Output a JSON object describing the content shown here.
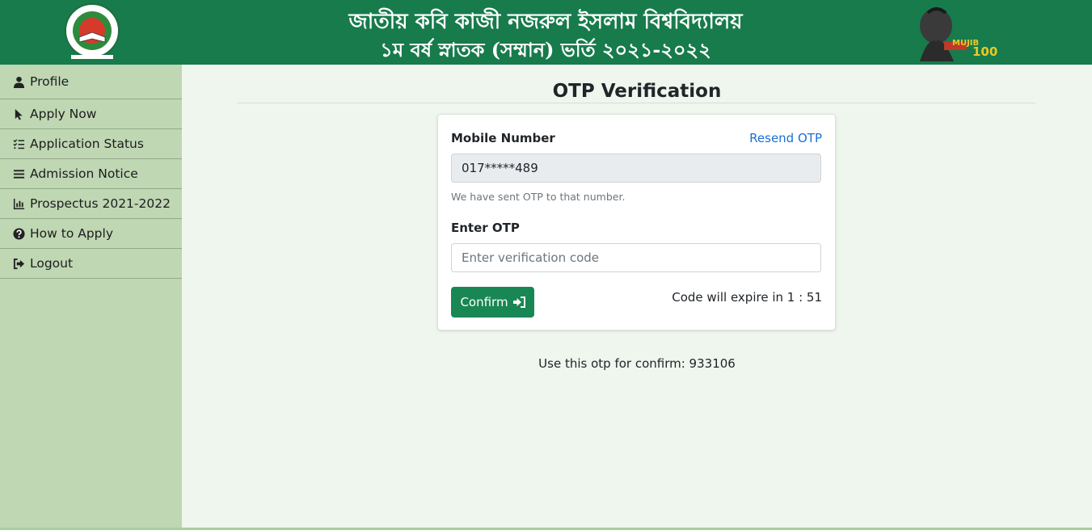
{
  "header": {
    "title_line1": "জাতীয় কবি কাজী নজরুল ইসলাম বিশ্ববিদ্যালয়",
    "title_line2": "১ম বর্ষ স্নাতক (সম্মান) ভর্তি ২০২১-২০২২",
    "logo_icon": "university-seal-logo",
    "mujib_logo_text": "MUJIB",
    "mujib_logo_number": "100",
    "brand_color": "#177b4c"
  },
  "sidebar": {
    "background": "#bfd7b3",
    "items": [
      {
        "label": "Profile",
        "icon": "user-icon"
      },
      {
        "label": "Apply Now",
        "icon": "cursor-icon"
      },
      {
        "label": "Application Status",
        "icon": "checklist-icon"
      },
      {
        "label": "Admission Notice",
        "icon": "bars-icon"
      },
      {
        "label": "Prospectus 2021-2022",
        "icon": "bar-chart-icon"
      },
      {
        "label": "How to Apply",
        "icon": "question-circle-icon"
      },
      {
        "label": "Logout",
        "icon": "logout-icon"
      }
    ]
  },
  "main": {
    "page_title": "OTP Verification",
    "form": {
      "mobile_label": "Mobile Number",
      "resend_label": "Resend OTP",
      "mobile_value": "017*****489",
      "help_text": "We have sent OTP to that number.",
      "otp_label": "Enter OTP",
      "otp_placeholder": "Enter verification code",
      "otp_value": "",
      "confirm_label": "Confirm",
      "timer_text": "Code will expire in 1 : 51"
    },
    "otp_hint": "Use this otp for confirm: 933106"
  },
  "colors": {
    "accent": "#198754",
    "link": "#1a6fd6",
    "page_bg": "#eff6ee"
  }
}
